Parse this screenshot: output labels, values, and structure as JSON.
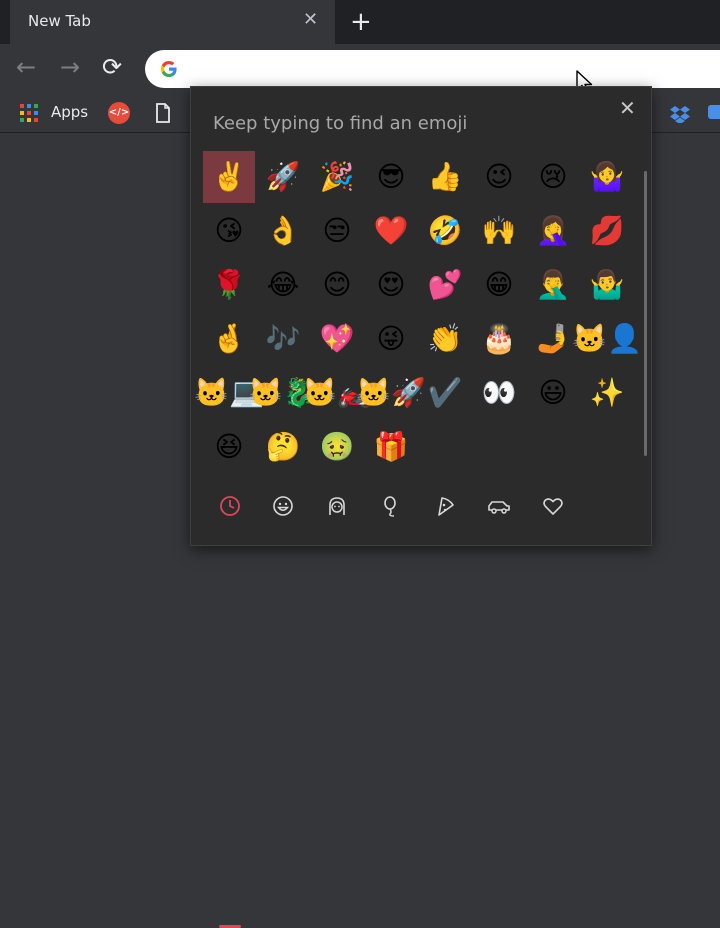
{
  "tab": {
    "title": "New Tab",
    "close_glyph": "✕"
  },
  "newtab_glyph": "+",
  "nav": {
    "back": "←",
    "forward": "→",
    "reload": "⟳"
  },
  "omnibox": {
    "logo": "google-logo"
  },
  "bookmarks": {
    "apps_label": "Apps"
  },
  "colors": {
    "tab_strip": "#202124",
    "toolbar": "#35363a",
    "panel_bg": "#2b2b2b",
    "selection": "#7a3a3f",
    "category_accent": "#e0455a"
  },
  "emoji_panel": {
    "hint": "Keep typing to find an emoji",
    "close_glyph": "✕",
    "selected_index": 0,
    "emojis": [
      "✌️",
      "🚀",
      "🎉",
      "😎",
      "👍",
      "😉",
      "😢",
      "🤷‍♀️",
      "😘",
      "👌",
      "😒",
      "❤️",
      "🤣",
      "🙌",
      "🤦‍♀️",
      "💋",
      "🌹",
      "😂",
      "😊",
      "😍",
      "💕",
      "😁",
      "🤦‍♂️",
      "🤷‍♂️",
      "🤞",
      "🎶",
      "💖",
      "😜",
      "👏",
      "🎂",
      "🤳",
      "🐱‍👤",
      "🐱‍💻",
      "🐱‍🐉",
      "🐱‍🏍",
      "🐱‍🚀",
      "✔️",
      "👀",
      "😃",
      "✨",
      "😆",
      "🤔",
      "🤢",
      "🎁"
    ],
    "categories": [
      {
        "name": "recent-icon",
        "active": true
      },
      {
        "name": "smiley-icon",
        "active": false
      },
      {
        "name": "people-icon",
        "active": false
      },
      {
        "name": "balloon-icon",
        "active": false
      },
      {
        "name": "pizza-icon",
        "active": false
      },
      {
        "name": "car-icon",
        "active": false
      },
      {
        "name": "heart-icon",
        "active": false
      }
    ]
  }
}
